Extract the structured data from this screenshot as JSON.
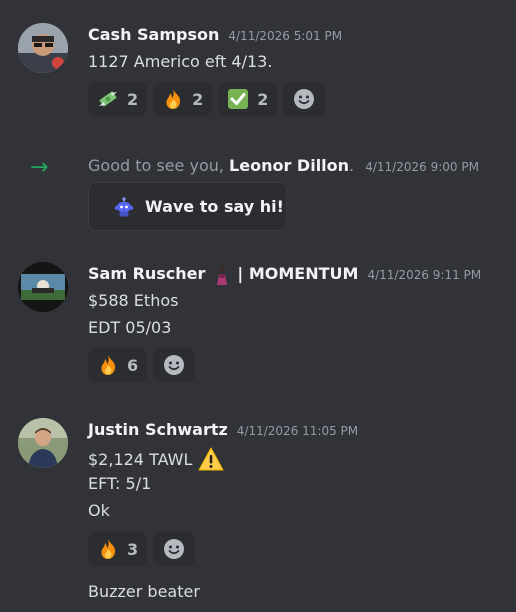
{
  "messages": [
    {
      "author": "Cash Sampson",
      "timestamp": "4/11/2026 5:01 PM",
      "lines": [
        "1127 Americo eft 4/13."
      ],
      "reactions": [
        {
          "icon": "money-wings-emoji",
          "count": "2"
        },
        {
          "icon": "fire-emoji",
          "count": "2"
        },
        {
          "icon": "check-mark-button-emoji",
          "count": "2"
        }
      ]
    },
    {
      "author": "Sam Ruscher",
      "author_suffix": "| MOMENTUM",
      "timestamp": "4/11/2026 9:11 PM",
      "lines": [
        "$588 Ethos",
        "EDT 05/03"
      ],
      "reactions": [
        {
          "icon": "fire-emoji",
          "count": "6"
        }
      ]
    },
    {
      "author": "Justin Schwartz",
      "timestamp": "4/11/2026 11:05 PM",
      "lines": [
        "$2,124 TAWL",
        "EFT: 5/1",
        "Ok"
      ],
      "reactions": [
        {
          "icon": "fire-emoji",
          "count": "3"
        }
      ],
      "followup": "Buzzer beater"
    }
  ],
  "join": {
    "prefix": "Good to see you, ",
    "name": "Leonor Dillon",
    "suffix": ".",
    "timestamp": "4/11/2026 9:00 PM",
    "button_label": "Wave to say hi!"
  },
  "colors": {
    "background": "#313338",
    "reaction_bg": "#2b2d31",
    "join_arrow": "#23a55a",
    "timestamp": "#949ba4"
  }
}
